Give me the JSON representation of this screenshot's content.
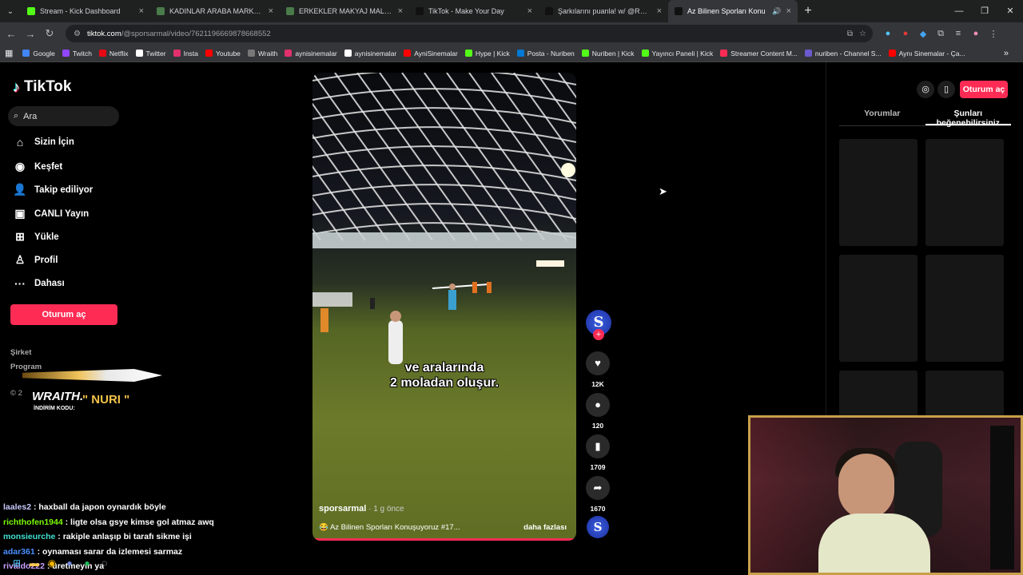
{
  "browser": {
    "tabs": [
      {
        "title": "Stream - Kick Dashboard",
        "fav": "#53fc18",
        "active": false
      },
      {
        "title": "KADINLAR ARABA MARKALARI",
        "fav": "#4a7b4a",
        "active": false
      },
      {
        "title": "ERKEKLER MAKYAJ MALZEMEL",
        "fav": "#4a7b4a",
        "active": false
      },
      {
        "title": "TikTok - Make Your Day",
        "fav": "#111111",
        "active": false
      },
      {
        "title": "Şarkılarını puanla! w/ @RAFET",
        "fav": "#111111",
        "active": false
      },
      {
        "title": "Az Bilinen Sporları Konu",
        "fav": "#111111",
        "active": true
      }
    ],
    "url_domain": "tiktok.com",
    "url_path": "/@sporsarmal/video/7621196669878668552",
    "bookmarks": [
      {
        "label": "Google",
        "color": "#4285f4"
      },
      {
        "label": "Twitch",
        "color": "#9146ff"
      },
      {
        "label": "Netflix",
        "color": "#e50914"
      },
      {
        "label": "Twitter",
        "color": "#ffffff"
      },
      {
        "label": "Insta",
        "color": "#e1306c"
      },
      {
        "label": "Youtube",
        "color": "#ff0000"
      },
      {
        "label": "Wraith",
        "color": "#777777"
      },
      {
        "label": "aynisinemalar",
        "color": "#e1306c"
      },
      {
        "label": "aynisinemalar",
        "color": "#ffffff"
      },
      {
        "label": "AyniSinemalar",
        "color": "#ff0000"
      },
      {
        "label": "Hype | Kick",
        "color": "#53fc18"
      },
      {
        "label": "Posta - Nuriben",
        "color": "#0078d4"
      },
      {
        "label": "Nuriben | Kick",
        "color": "#53fc18"
      },
      {
        "label": "Yayıncı Paneli | Kick",
        "color": "#53fc18"
      },
      {
        "label": "Streamer Content M...",
        "color": "#fe2c55"
      },
      {
        "label": "nuriben - Channel S...",
        "color": "#6a5acd"
      },
      {
        "label": "Aynı Sinemalar - Ça...",
        "color": "#ff0000"
      }
    ]
  },
  "sidebar": {
    "logo": "TikTok",
    "search_placeholder": "Ara",
    "items": [
      {
        "label": "Sizin İçin",
        "icon": "⌂",
        "name": "home"
      },
      {
        "label": "Keşfet",
        "icon": "◉",
        "name": "compass"
      },
      {
        "label": "Takip ediliyor",
        "icon": "👤",
        "name": "user-plus"
      },
      {
        "label": "CANLI Yayın",
        "icon": "▣",
        "name": "live"
      },
      {
        "label": "Yükle",
        "icon": "⊞",
        "name": "upload"
      },
      {
        "label": "Profil",
        "icon": "♙",
        "name": "profile"
      },
      {
        "label": "Dahası",
        "icon": "···",
        "name": "more"
      }
    ],
    "login": "Oturum aç",
    "company": "Şirket",
    "program": "Program",
    "copyright": "© 2"
  },
  "overlay": {
    "brand": "WRAITH.",
    "code_label": "İNDİRİM KODU:",
    "code": "\" NURI \""
  },
  "chat": [
    {
      "user": "laales2",
      "color": "#c9c9ff",
      "msg": "haxball da japon oynardık böyle"
    },
    {
      "user": "richthofen1944",
      "color": "#7cfc00",
      "msg": "ligte olsa gsye kimse gol atmaz awq"
    },
    {
      "user": "monsieurche",
      "color": "#40e0d0",
      "msg": "rakiple anlaşıp bi tarafı sikme işi"
    },
    {
      "user": "adar361",
      "color": "#4a90ff",
      "msg": "oynaması sarar da izlemesi sarmaz"
    },
    {
      "user": "rivaldo222",
      "color": "#c9a0ff",
      "msg": "üretmeyin ya"
    }
  ],
  "video": {
    "caption_line1": "ve aralarında",
    "caption_line2": "2 moladan oluşur.",
    "author": "sporsarmal",
    "ago": " · 1 g önce",
    "desc": "😂 Az Bilinen Sporları Konuşuyoruz #17...",
    "more": "daha fazlası",
    "progress": 1.0
  },
  "actions": {
    "likes": "12K",
    "comments": "120",
    "saves": "1709",
    "shares": "1670"
  },
  "right": {
    "login": "Oturum aç",
    "tab_comments": "Yorumlar",
    "tab_like": "Şunları beğenebilirsiniz"
  }
}
